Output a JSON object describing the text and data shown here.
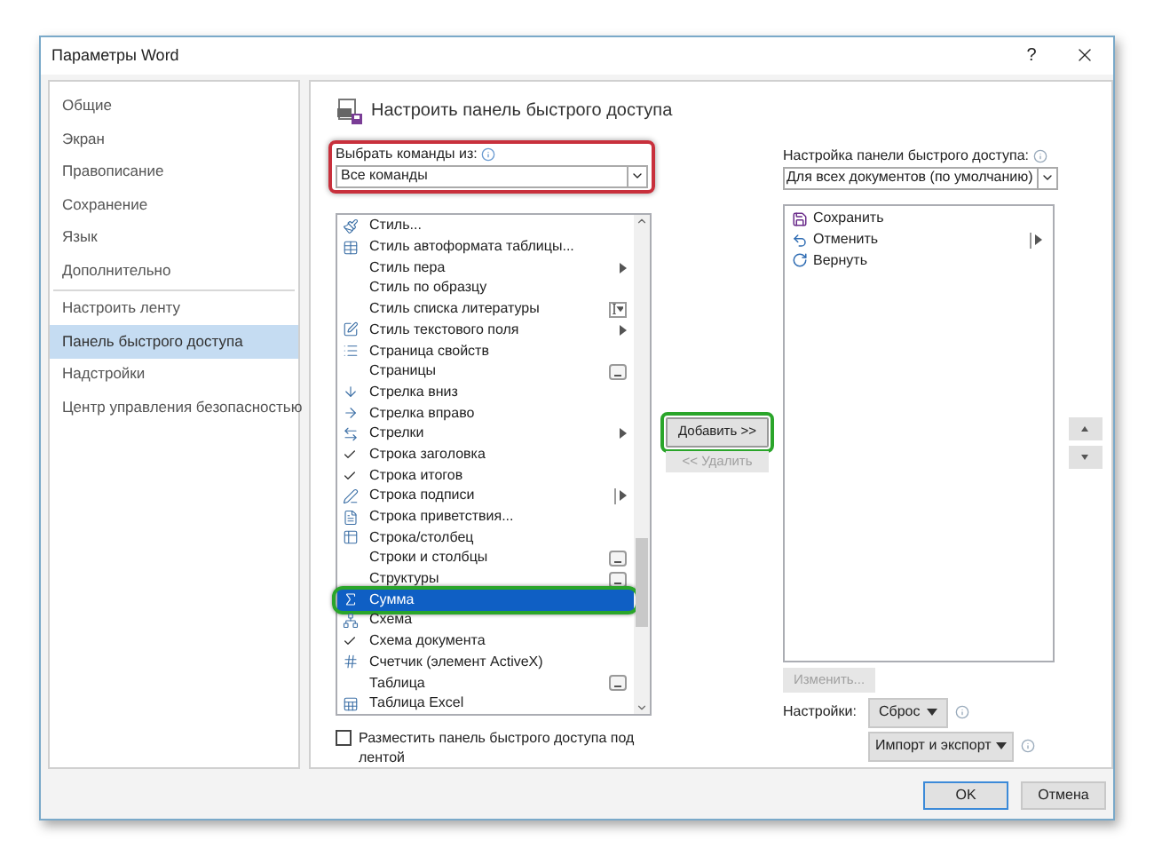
{
  "window": {
    "title": "Параметры Word",
    "help": "?"
  },
  "nav": [
    {
      "label": "Общие",
      "selected": false
    },
    {
      "label": "Экран",
      "selected": false
    },
    {
      "label": "Правописание",
      "selected": false
    },
    {
      "label": "Сохранение",
      "selected": false
    },
    {
      "label": "Язык",
      "selected": false
    },
    {
      "label": "Дополнительно",
      "selected": false
    },
    {
      "label": "Настроить ленту",
      "selected": false
    },
    {
      "label": "Панель быстрого доступа",
      "selected": true
    },
    {
      "label": "Надстройки",
      "selected": false
    },
    {
      "label": "Центр управления безопасностью",
      "selected": false
    }
  ],
  "header": "Настроить панель быстрого доступа",
  "choose_from": {
    "label": "Выбрать команды из:",
    "value": "Все команды"
  },
  "commands": [
    {
      "label": "Стиль...",
      "checked": false,
      "selected": false,
      "kind": "plain"
    },
    {
      "label": "Стиль автоформата таблицы...",
      "checked": false,
      "selected": false,
      "kind": "plain"
    },
    {
      "label": "Стиль пера",
      "checked": false,
      "selected": false,
      "kind": "submenu"
    },
    {
      "label": "Стиль по образцу",
      "checked": false,
      "selected": false,
      "kind": "plain"
    },
    {
      "label": "Стиль списка литературы",
      "checked": false,
      "selected": false,
      "kind": "combo"
    },
    {
      "label": "Стиль текстового поля",
      "checked": false,
      "selected": false,
      "kind": "submenu"
    },
    {
      "label": "Страница свойств",
      "checked": false,
      "selected": false,
      "kind": "plain"
    },
    {
      "label": "Страницы",
      "checked": false,
      "selected": false,
      "kind": "gallery"
    },
    {
      "label": "Стрелка вниз",
      "checked": false,
      "selected": false,
      "kind": "plain"
    },
    {
      "label": "Стрелка вправо",
      "checked": false,
      "selected": false,
      "kind": "plain"
    },
    {
      "label": "Стрелки",
      "checked": false,
      "selected": false,
      "kind": "submenu"
    },
    {
      "label": "Строка заголовка",
      "checked": true,
      "selected": false,
      "kind": "plain"
    },
    {
      "label": "Строка итогов",
      "checked": true,
      "selected": false,
      "kind": "plain"
    },
    {
      "label": "Строка подписи",
      "checked": false,
      "selected": false,
      "kind": "split"
    },
    {
      "label": "Строка приветствия...",
      "checked": false,
      "selected": false,
      "kind": "plain"
    },
    {
      "label": "Строка/столбец",
      "checked": false,
      "selected": false,
      "kind": "plain"
    },
    {
      "label": "Строки и столбцы",
      "checked": false,
      "selected": false,
      "kind": "gallery"
    },
    {
      "label": "Структуры",
      "checked": false,
      "selected": false,
      "kind": "gallery"
    },
    {
      "label": "Сумма",
      "checked": false,
      "selected": true,
      "kind": "plain"
    },
    {
      "label": "Схема",
      "checked": false,
      "selected": false,
      "kind": "plain"
    },
    {
      "label": "Схема документа",
      "checked": true,
      "selected": false,
      "kind": "plain"
    },
    {
      "label": "Счетчик (элемент ActiveX)",
      "checked": false,
      "selected": false,
      "kind": "plain"
    },
    {
      "label": "Таблица",
      "checked": false,
      "selected": false,
      "kind": "gallery"
    },
    {
      "label": "Таблица Excel",
      "checked": false,
      "selected": false,
      "kind": "plain"
    }
  ],
  "add_button": {
    "label": "Добавить >>",
    "disabled": false
  },
  "remove_button": {
    "label": "<< Удалить",
    "disabled": true
  },
  "customize": {
    "label": "Настройка панели быстрого доступа:",
    "value": "Для всех документов (по умолчанию)"
  },
  "toolbar_items": [
    {
      "label": "Сохранить",
      "selected": false,
      "kind": "plain"
    },
    {
      "label": "Отменить",
      "selected": false,
      "kind": "split"
    },
    {
      "label": "Вернуть",
      "selected": false,
      "kind": "plain"
    }
  ],
  "modify_button": {
    "label": "Изменить...",
    "disabled": true
  },
  "settings_label": "Настройки:",
  "reset_button": "Сброс",
  "import_export_button": "Импорт и экспорт",
  "below_ribbon": {
    "label": "Разместить панель быстрого доступа под лентой",
    "checked": false
  },
  "buttons": [
    {
      "label": "OK",
      "kind": "default"
    },
    {
      "label": "Отмена",
      "kind": "normal"
    }
  ]
}
